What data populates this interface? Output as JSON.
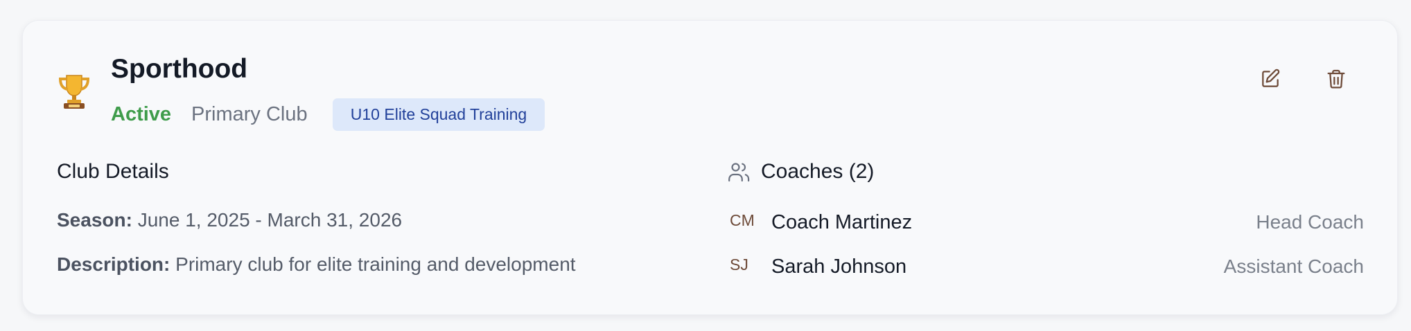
{
  "club": {
    "name": "Sporthood",
    "status": "Active",
    "type": "Primary Club",
    "tag": "U10 Elite Squad Training",
    "icon": "trophy-icon"
  },
  "actions": {
    "edit_icon": "edit-icon",
    "delete_icon": "trash-icon"
  },
  "details": {
    "title": "Club Details",
    "season_label": "Season:",
    "season_value": "June 1, 2025 - March 31, 2026",
    "description_label": "Description:",
    "description_value": "Primary club for elite training and development"
  },
  "coaches": {
    "title": "Coaches (2)",
    "icon": "users-icon",
    "items": [
      {
        "initials": "CM",
        "name": "Coach Martinez",
        "role": "Head Coach"
      },
      {
        "initials": "SJ",
        "name": "Sarah Johnson",
        "role": "Assistant Coach"
      }
    ]
  },
  "colors": {
    "status_active": "#3f9c4b",
    "tag_background": "#dde8fa",
    "tag_text": "#21409a",
    "icon_brown": "#6d4a38"
  }
}
